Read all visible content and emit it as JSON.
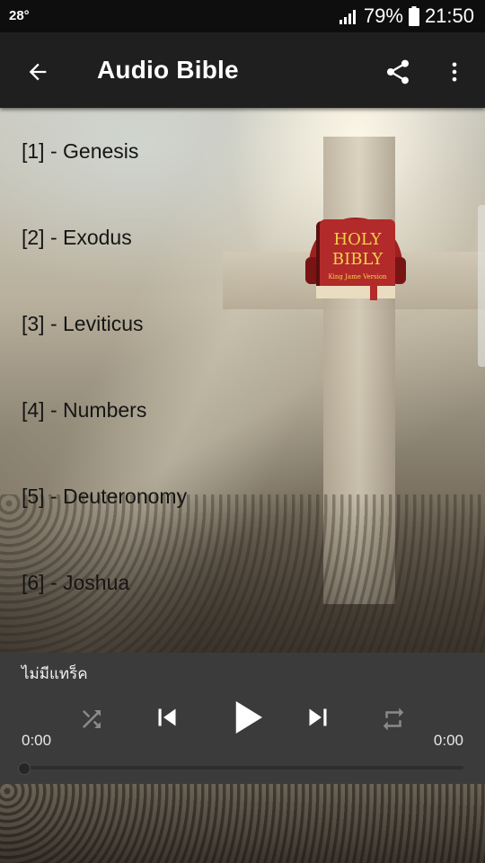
{
  "status_bar": {
    "temperature": "28°",
    "battery": "79%",
    "time": "21:50"
  },
  "app_bar": {
    "title": "Audio Bible",
    "icons": [
      "back-arrow-icon",
      "share-icon",
      "more-vert-icon"
    ]
  },
  "logo": {
    "line1": "HOLY",
    "line2": "BIBLY",
    "line3": "King Jame Version"
  },
  "chapters": [
    {
      "label": "[1] - Genesis"
    },
    {
      "label": "[2] - Exodus"
    },
    {
      "label": "[3] - Leviticus"
    },
    {
      "label": "[4] - Numbers"
    },
    {
      "label": "[5] - Deuteronomy"
    },
    {
      "label": "[6] - Joshua"
    }
  ],
  "player": {
    "track_title": "ไม่มีแทร็ค",
    "current_time": "0:00",
    "duration": "0:00",
    "progress": 0,
    "icons": [
      "shuffle-icon",
      "skip-previous-icon",
      "play-icon",
      "skip-next-icon",
      "repeat-icon"
    ]
  },
  "colors": {
    "status_bar": "#0e0e0e",
    "app_bar": "#1f1f1f",
    "player": "#3b3b3b",
    "logo_red": "#b22a2a"
  }
}
